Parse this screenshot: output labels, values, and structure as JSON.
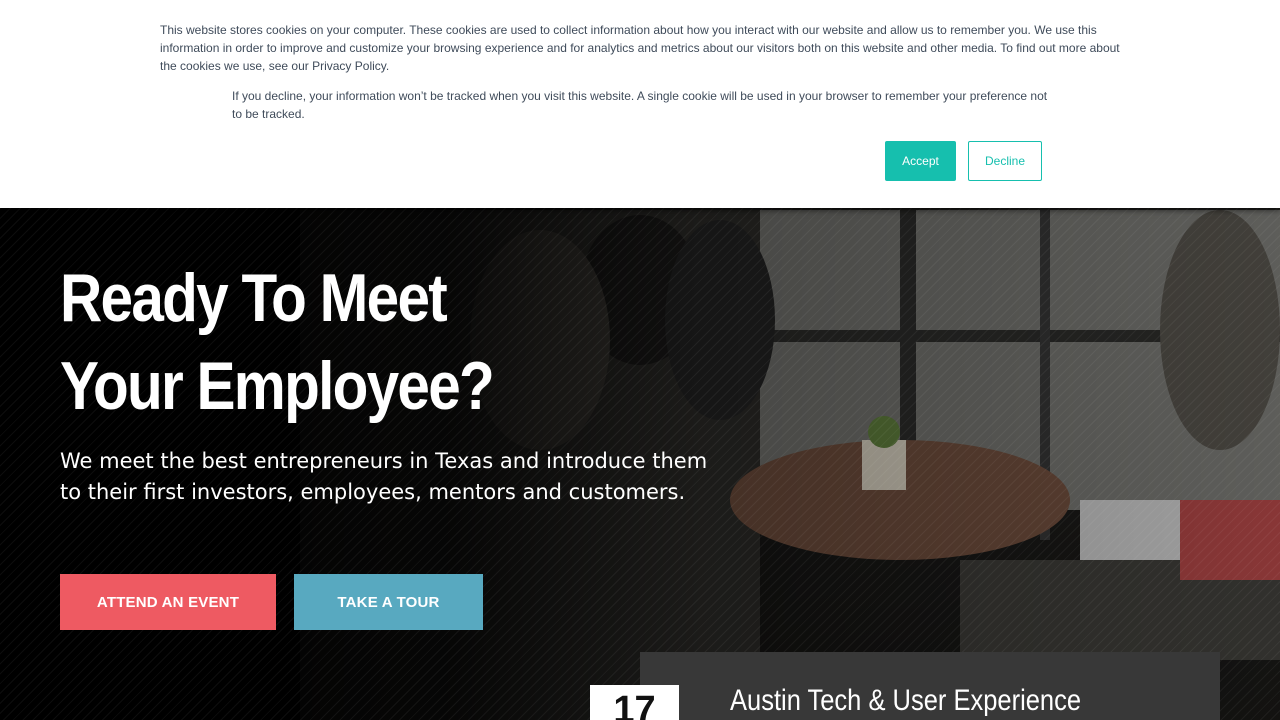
{
  "cookie_banner": {
    "text_primary": "This website stores cookies on your computer. These cookies are used to collect information about how you interact with our website and allow us to remember you. We use this information in order to improve and customize your browsing experience and for analytics and metrics about our visitors both on this website and other media. To find out more about the cookies we use, see our Privacy Policy.",
    "text_secondary": "If you decline, your information won’t be tracked when you visit this website. A single cookie will be used in your browser to remember your preference not to be tracked.",
    "accept_label": "Accept",
    "decline_label": "Decline",
    "accent_color": "#16bfae"
  },
  "hero": {
    "title_line1": "Ready To Meet",
    "title_line2": "Your Employee?",
    "subtitle": "We meet the best entrepreneurs in Texas and introduce them to their first investors, employees, mentors and customers.",
    "primary_button": "ATTEND AN EVENT",
    "secondary_button": "TAKE A TOUR",
    "primary_color": "#ee5a62",
    "secondary_color": "#58a9c0"
  },
  "event": {
    "day": "17",
    "title": "Austin Tech & User Experience"
  }
}
